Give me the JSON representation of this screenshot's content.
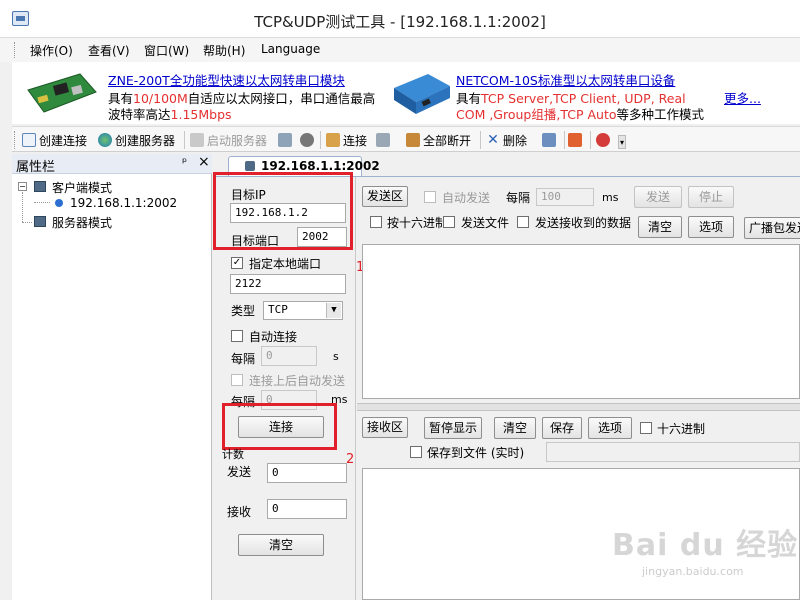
{
  "window": {
    "title": "TCP&UDP测试工具 - [192.168.1.1:2002]"
  },
  "menu": [
    "操作(O)",
    "查看(V)",
    "窗口(W)",
    "帮助(H)",
    "Language"
  ],
  "banner": {
    "ad1": {
      "link": "ZNE-200T全功能型快速以太网转串口模块",
      "line2_a": "具有",
      "line2_b": "10/100M",
      "line2_c": "自适应以太网接口，串口通信最高",
      "line3_a": "波特率高达",
      "line3_b": "1.15Mbps"
    },
    "ad2": {
      "link": "NETCOM-10S标准型以太网转串口设备",
      "line2_a": "具有",
      "line2_b": "TCP Server,TCP Client, UDP, Real",
      "line3_b1": "COM ,Group组播,TCP Auto",
      "line3_c": "等多种工作模式"
    },
    "more": "更多..."
  },
  "toolbar": {
    "create_conn": "创建连接",
    "create_server": "创建服务器",
    "start_server": "启动服务器",
    "connect": "连接",
    "disconnect_all": "全部断开",
    "delete": "删除"
  },
  "left": {
    "title": "属性栏",
    "pin": "ᵖ",
    "close": "×",
    "client_mode": "客户端模式",
    "client_item": "192.168.1.1:2002",
    "server_mode": "服务器模式"
  },
  "tab": {
    "label": "192.168.1.1:2002"
  },
  "settings": {
    "target_ip_label": "目标IP",
    "target_ip": "192.168.1.2",
    "target_port_label": "目标端口",
    "target_port": "2002",
    "specify_local_port": "指定本地端口",
    "local_port": "2122",
    "type_label": "类型",
    "type_value": "TCP",
    "auto_connect": "自动连接",
    "interval_label": "每隔",
    "interval_value": "0",
    "interval_unit": "s",
    "auto_send_after_connect": "连接上后自动发送",
    "interval2_label": "每隔",
    "interval2_value": "0",
    "interval2_unit": "ms",
    "connect_button": "连接",
    "count_label": "计数",
    "send_label": "发送",
    "send_count": "0",
    "recv_label": "接收",
    "recv_count": "0",
    "clear_button": "清空"
  },
  "annotations": {
    "n1": "1",
    "n2": "2"
  },
  "send": {
    "area_label": "发送区",
    "auto_send": "自动发送",
    "interval_label": "每隔",
    "interval_value": "100",
    "unit": "ms",
    "send_button": "发送",
    "stop_button": "停止",
    "hex": "按十六进制",
    "send_file": "发送文件",
    "send_received": "发送接收到的数据",
    "clear_button": "清空",
    "options_button": "选项",
    "broadcast_button": "广播包发送"
  },
  "recv": {
    "area_label": "接收区",
    "pause_button": "暂停显示",
    "clear_button": "清空",
    "save_button": "保存",
    "options_button": "选项",
    "hex": "十六进制",
    "save_to_file": "保存到文件 (实时)"
  },
  "watermark": {
    "main": "Bai du 经验",
    "sub": "jingyan.baidu.com"
  },
  "colors": {
    "accent_red": "#e0202a",
    "link_blue": "#0000cc",
    "highlight_red": "#e53030"
  }
}
